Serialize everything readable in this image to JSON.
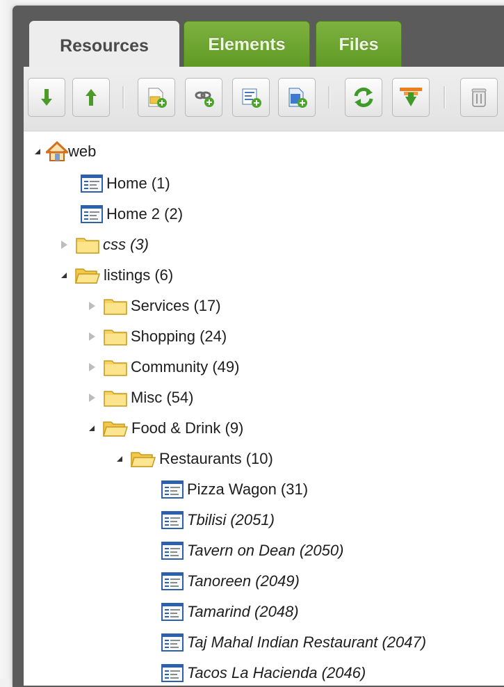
{
  "tabs": [
    {
      "label": "Resources",
      "active": true
    },
    {
      "label": "Elements",
      "active": false
    },
    {
      "label": "Files",
      "active": false
    }
  ],
  "toolbar": {
    "buttons": [
      {
        "icon": "arrow-down-icon"
      },
      {
        "icon": "arrow-up-icon"
      },
      {
        "icon": "new-document-icon"
      },
      {
        "icon": "new-weblink-icon"
      },
      {
        "icon": "new-symlink-icon"
      },
      {
        "icon": "new-static-resource-icon"
      },
      {
        "icon": "refresh-icon"
      },
      {
        "icon": "sort-icon"
      },
      {
        "icon": "trash-icon"
      }
    ]
  },
  "tree": {
    "root": {
      "label": "web",
      "icon": "home-icon"
    },
    "items": [
      {
        "label": "Home (1)",
        "type": "document"
      },
      {
        "label": "Home 2 (2)",
        "type": "document"
      },
      {
        "label": "css (3)",
        "type": "folder",
        "collapsed": true,
        "italic": true
      },
      {
        "label": "listings (6)",
        "type": "folder",
        "expanded": true
      },
      {
        "label": "Services (17)",
        "type": "folder",
        "collapsed": true
      },
      {
        "label": "Shopping (24)",
        "type": "folder",
        "collapsed": true
      },
      {
        "label": "Community (49)",
        "type": "folder",
        "collapsed": true
      },
      {
        "label": "Misc (54)",
        "type": "folder",
        "collapsed": true
      },
      {
        "label": "Food & Drink (9)",
        "type": "folder",
        "expanded": true
      },
      {
        "label": "Restaurants (10)",
        "type": "folder",
        "expanded": true
      },
      {
        "label": "Pizza Wagon (31)",
        "type": "document"
      },
      {
        "label": "Tbilisi (2051)",
        "type": "document",
        "italic": true
      },
      {
        "label": "Tavern on Dean (2050)",
        "type": "document",
        "italic": true
      },
      {
        "label": "Tanoreen (2049)",
        "type": "document",
        "italic": true
      },
      {
        "label": "Tamarind (2048)",
        "type": "document",
        "italic": true
      },
      {
        "label": "Taj Mahal Indian Restaurant (2047)",
        "type": "document",
        "italic": true
      },
      {
        "label": "Tacos La Hacienda (2046)",
        "type": "document",
        "italic": true
      }
    ]
  },
  "colors": {
    "tab_green": "#6ca52f",
    "panel_dark": "#5b5b5b",
    "folder_yellow": "#f5cd4a"
  }
}
